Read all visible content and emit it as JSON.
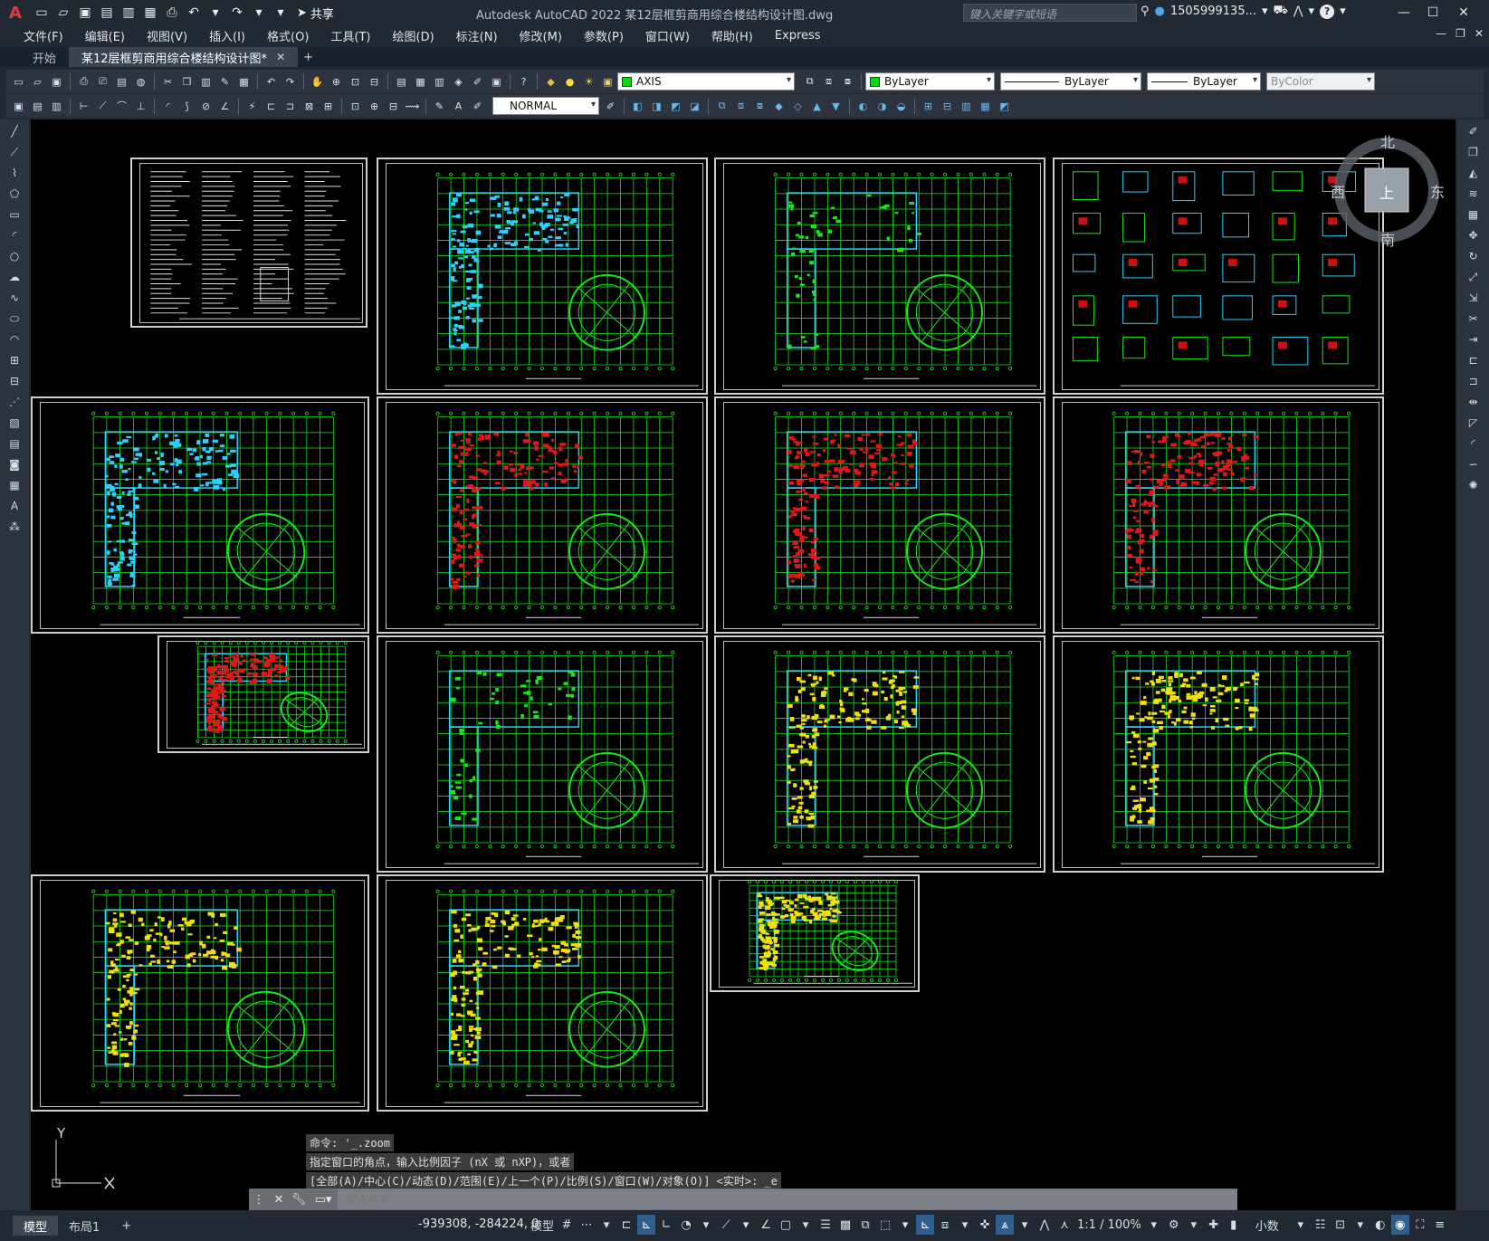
{
  "app": {
    "logo": "A",
    "window_title": "Autodesk AutoCAD 2022    某12层框剪商用综合楼结构设计图.dwg",
    "share_label": "共享",
    "search_placeholder": "键入关键字或短语",
    "user": "1505999135...",
    "help": "?"
  },
  "menu": [
    "文件(F)",
    "编辑(E)",
    "视图(V)",
    "插入(I)",
    "格式(O)",
    "工具(T)",
    "绘图(D)",
    "标注(N)",
    "修改(M)",
    "参数(P)",
    "窗口(W)",
    "帮助(H)",
    "Express"
  ],
  "tabs": {
    "start": "开始",
    "active": "某12层框剪商用综合楼结构设计图*",
    "close": "✕",
    "add": "+"
  },
  "toolbar": {
    "layer": "AXIS",
    "color": "ByLayer",
    "linetype": "ByLayer",
    "lineweight": "ByLayer",
    "plotstyle": "ByColor",
    "textstyle": "NORMAL",
    "layer_color": "#11d511"
  },
  "viewcube": {
    "north": "北",
    "south": "南",
    "east": "东",
    "west": "西",
    "face": "上"
  },
  "ucs": {
    "y": "Y"
  },
  "command": {
    "history": [
      "命令: '_.zoom",
      "指定窗口的角点，输入比例因子 (nX 或 nXP)，或者",
      "[全部(A)/中心(C)/动态(D)/范围(E)/上一个(P)/比例(S)/窗口(W)/对象(O)] <实时>: _e"
    ],
    "placeholder": "键入命令"
  },
  "status": {
    "model_tab": "模型",
    "layout_tab": "布局1",
    "add": "+",
    "coords": "-939308, -284224, 0",
    "space": "模型",
    "scale": "1:1 / 100%",
    "units": "小数"
  },
  "sheets": [
    {
      "id": "s1",
      "kind": "notes"
    },
    {
      "id": "s2",
      "kind": "plan-cyan"
    },
    {
      "id": "s3",
      "kind": "plan-sparse"
    },
    {
      "id": "s4",
      "kind": "details"
    },
    {
      "id": "s5",
      "kind": "plan-cyan"
    },
    {
      "id": "s6",
      "kind": "plan-red"
    },
    {
      "id": "s7",
      "kind": "plan-red"
    },
    {
      "id": "s8",
      "kind": "plan-red"
    },
    {
      "id": "s9",
      "kind": "plan-red-small"
    },
    {
      "id": "s10",
      "kind": "plan-sparse"
    },
    {
      "id": "s11",
      "kind": "plan-yellow"
    },
    {
      "id": "s12",
      "kind": "plan-yellow"
    },
    {
      "id": "s13",
      "kind": "plan-yellow"
    },
    {
      "id": "s14",
      "kind": "plan-yellow"
    },
    {
      "id": "s15",
      "kind": "plan-yellow-small"
    }
  ]
}
